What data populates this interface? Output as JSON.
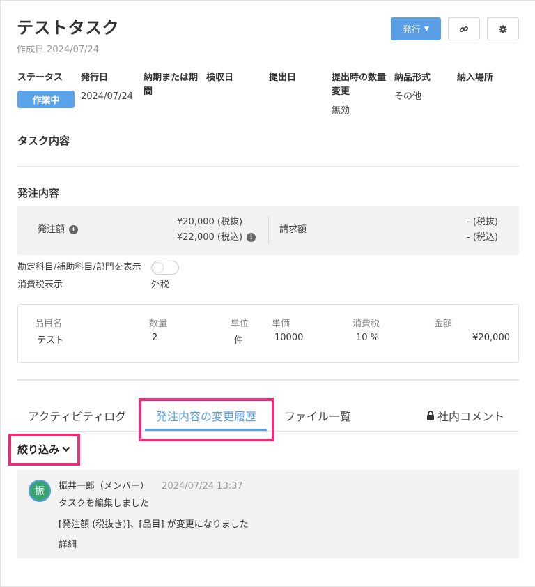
{
  "header": {
    "title": "テストタスク",
    "created_label": "作成日",
    "created_date": "2024/07/24",
    "issue_button": "発行",
    "link_icon": "link-icon",
    "gear_icon": "gear-icon"
  },
  "meta": {
    "status_label": "ステータス",
    "status_value": "作業中",
    "issue_date_label": "発行日",
    "issue_date_value": "2024/07/24",
    "due_label_line1": "納期または期",
    "due_label_line2": "間",
    "inspection_label": "検収日",
    "submit_label": "提出日",
    "qty_change_label_line1": "提出時の数量",
    "qty_change_label_line2": "変更",
    "qty_change_value": "無効",
    "delivery_format_label": "納品形式",
    "delivery_format_value": "その他",
    "delivery_place_label": "納入場所"
  },
  "task_content": {
    "heading": "タスク内容"
  },
  "order": {
    "heading": "発注内容",
    "amount_label": "発注額",
    "amount_excl": "¥20,000 (税抜)",
    "amount_incl": "¥22,000 (税込)",
    "invoice_label": "請求額",
    "invoice_excl": "- (税抜)",
    "invoice_incl": "- (税込)",
    "toggle_label": "勘定科目/補助科目/部門を表示",
    "tax_display_label": "消費税表示",
    "tax_display_value": "外税"
  },
  "items": {
    "columns": [
      "品目名",
      "数量",
      "単位",
      "単価",
      "消費税",
      "金額"
    ],
    "rows": [
      [
        "テスト",
        "2",
        "件",
        "10000",
        "10 %",
        "¥20,000"
      ]
    ]
  },
  "tabs": {
    "activity": "アクティビティログ",
    "history": "発注内容の変更履歴",
    "files": "ファイル一覧",
    "internal": "社内コメント"
  },
  "filter": {
    "label": "絞り込み"
  },
  "activity_entry": {
    "avatar_char": "振",
    "user": "振井一郎（メンバー）",
    "datetime": "2024/07/24 13:37",
    "line1": "タスクを編集しました",
    "line2": "[発注額 (税抜き)]、[品目] が変更になりました",
    "details_link": "詳細"
  }
}
